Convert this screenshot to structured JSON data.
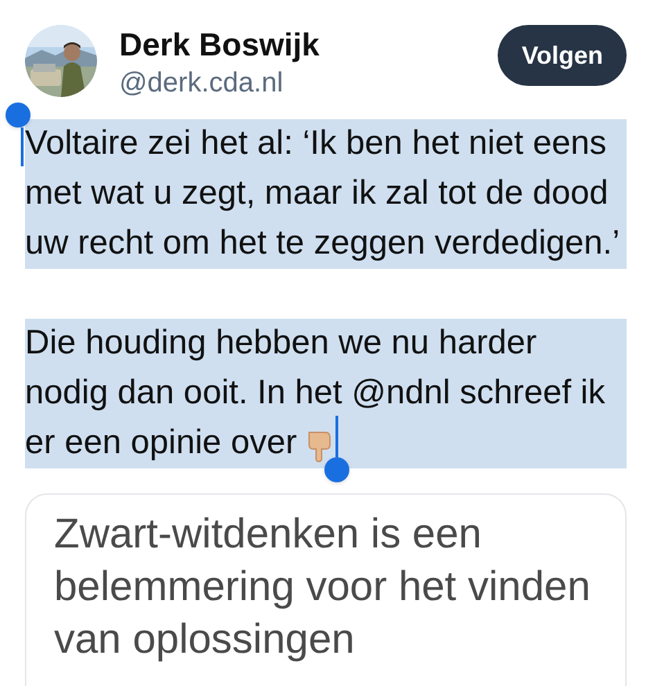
{
  "author": {
    "name": "Derk Boswijk",
    "handle": "@derk.cda.nl"
  },
  "follow_button": {
    "label": "Volgen"
  },
  "post": {
    "selected": true,
    "paragraphs": [
      "Voltaire zei het al: ‘Ik ben het niet eens met wat u zegt, maar ik zal tot de dood uw recht om het te zeggen verdedigen.’",
      "Die houding hebben we nu harder nodig dan ooit. In het @ndnl schreef ik er een opinie over"
    ]
  },
  "link_card": {
    "title": "Zwart-witdenken is een belemmering voor het vinden van oplossingen"
  }
}
